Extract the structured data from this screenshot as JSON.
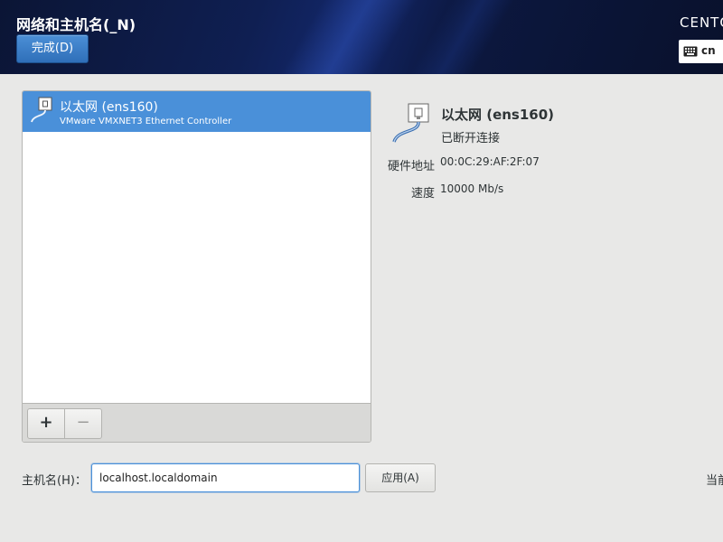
{
  "header": {
    "title": "网络和主机名(_N)",
    "done_label": "完成(D)",
    "distro": "CENTOS",
    "keyboard_layout": "cn"
  },
  "connections": [
    {
      "name": "以太网 (ens160)",
      "description": "VMware VMXNET3 Ethernet Controller",
      "selected": true
    }
  ],
  "list_toolbar": {
    "add_label": "+",
    "remove_label": "−"
  },
  "details": {
    "name": "以太网 (ens160)",
    "status": "已断开连接",
    "properties": [
      {
        "label": "硬件地址",
        "value": "00:0C:29:AF:2F:07"
      },
      {
        "label": "速度",
        "value": "10000 Mb/s"
      }
    ]
  },
  "hostname": {
    "label": "主机名(H)：",
    "value": "localhost.localdomain",
    "apply_label": "应用(A)",
    "current_label": "当前"
  },
  "colors": {
    "header_bg": "#0f1f52",
    "accent": "#4a90d9",
    "page_bg": "#e8e8e7"
  },
  "icons": [
    "network-wired-icon",
    "keyboard-icon"
  ]
}
